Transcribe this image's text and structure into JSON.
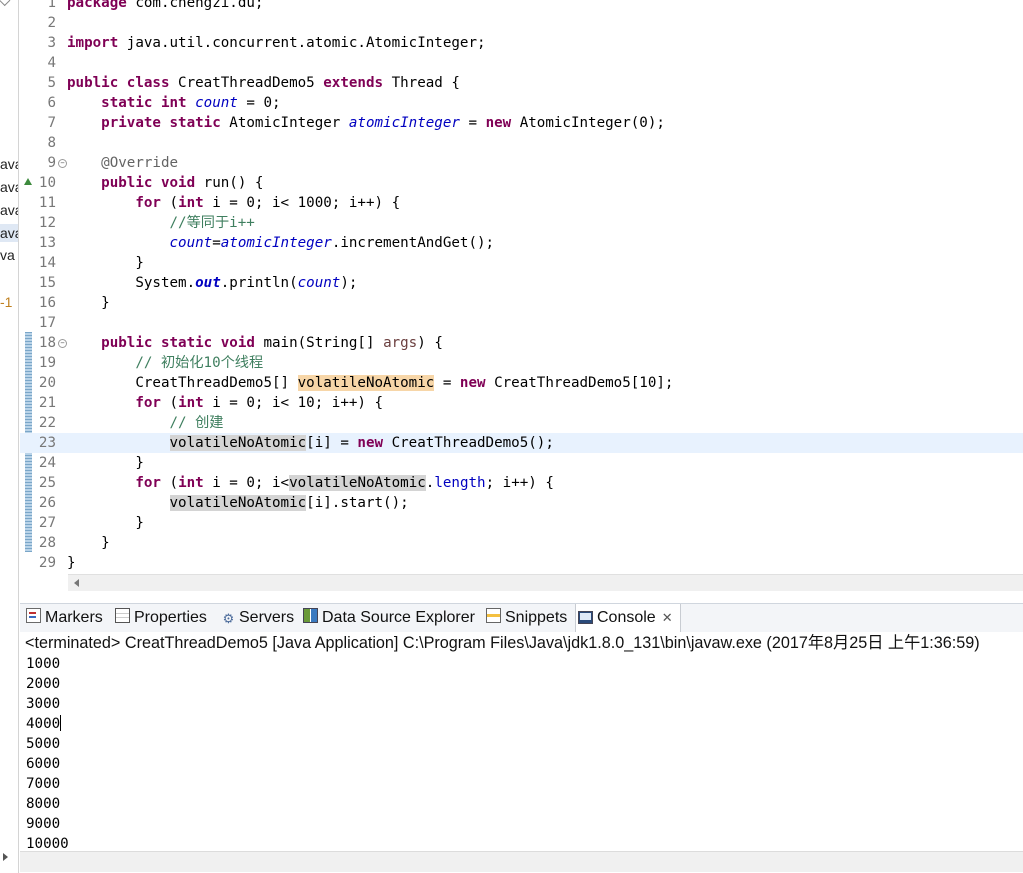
{
  "package_explorer": {
    "fragments": [
      "ava",
      "ava",
      "ava",
      "ava",
      "va",
      "-1"
    ]
  },
  "editor": {
    "current_line": 23,
    "lines": [
      {
        "n": "1",
        "segs": [
          [
            "kw",
            "package"
          ],
          [
            "t",
            " com.chengzi.du;"
          ]
        ]
      },
      {
        "n": "2",
        "segs": []
      },
      {
        "n": "3",
        "segs": [
          [
            "kw",
            "import"
          ],
          [
            "t",
            " java.util.concurrent.atomic.AtomicInteger;"
          ]
        ]
      },
      {
        "n": "4",
        "segs": []
      },
      {
        "n": "5",
        "segs": [
          [
            "kw",
            "public"
          ],
          [
            "t",
            " "
          ],
          [
            "kw",
            "class"
          ],
          [
            "t",
            " CreatThreadDemo5 "
          ],
          [
            "kw",
            "extends"
          ],
          [
            "t",
            " Thread {"
          ]
        ]
      },
      {
        "n": "6",
        "segs": [
          [
            "t",
            "    "
          ],
          [
            "kw",
            "static"
          ],
          [
            "t",
            " "
          ],
          [
            "kw",
            "int"
          ],
          [
            "t",
            " "
          ],
          [
            "fld",
            "count"
          ],
          [
            "t",
            " = 0;"
          ]
        ]
      },
      {
        "n": "7",
        "segs": [
          [
            "t",
            "    "
          ],
          [
            "kw",
            "private"
          ],
          [
            "t",
            " "
          ],
          [
            "kw",
            "static"
          ],
          [
            "t",
            " AtomicInteger "
          ],
          [
            "fld",
            "atomicInteger"
          ],
          [
            "t",
            " = "
          ],
          [
            "kw",
            "new"
          ],
          [
            "t",
            " AtomicInteger(0);"
          ]
        ]
      },
      {
        "n": "8",
        "segs": []
      },
      {
        "n": "9",
        "fold": true,
        "segs": [
          [
            "t",
            "    "
          ],
          [
            "an",
            "@Override"
          ]
        ]
      },
      {
        "n": "10",
        "override": true,
        "segs": [
          [
            "t",
            "    "
          ],
          [
            "kw",
            "public"
          ],
          [
            "t",
            " "
          ],
          [
            "kw",
            "void"
          ],
          [
            "t",
            " run() {"
          ]
        ]
      },
      {
        "n": "11",
        "segs": [
          [
            "t",
            "        "
          ],
          [
            "kw",
            "for"
          ],
          [
            "t",
            " ("
          ],
          [
            "kw",
            "int"
          ],
          [
            "t",
            " i = 0; i< 1000; i++) {"
          ]
        ]
      },
      {
        "n": "12",
        "segs": [
          [
            "t",
            "            "
          ],
          [
            "cm",
            "//等同于i++"
          ]
        ]
      },
      {
        "n": "13",
        "segs": [
          [
            "t",
            "            "
          ],
          [
            "fld",
            "count"
          ],
          [
            "t",
            "="
          ],
          [
            "fld",
            "atomicInteger"
          ],
          [
            "t",
            ".incrementAndGet();"
          ]
        ]
      },
      {
        "n": "14",
        "segs": [
          [
            "t",
            "        }"
          ]
        ]
      },
      {
        "n": "15",
        "segs": [
          [
            "t",
            "        System."
          ],
          [
            "sfld",
            "out"
          ],
          [
            "t",
            ".println("
          ],
          [
            "fld",
            "count"
          ],
          [
            "t",
            ");"
          ]
        ]
      },
      {
        "n": "16",
        "segs": [
          [
            "t",
            "    }"
          ]
        ]
      },
      {
        "n": "17",
        "segs": []
      },
      {
        "n": "18",
        "fold": true,
        "segs": [
          [
            "t",
            "    "
          ],
          [
            "kw",
            "public"
          ],
          [
            "t",
            " "
          ],
          [
            "kw",
            "static"
          ],
          [
            "t",
            " "
          ],
          [
            "kw",
            "void"
          ],
          [
            "t",
            " main(String[] "
          ],
          [
            "prm",
            "args"
          ],
          [
            "t",
            ") {"
          ]
        ]
      },
      {
        "n": "19",
        "segs": [
          [
            "t",
            "        "
          ],
          [
            "cm",
            "// 初始化10个线程"
          ]
        ]
      },
      {
        "n": "20",
        "segs": [
          [
            "t",
            "        CreatThreadDemo5[] "
          ],
          [
            "hlw",
            "volatileNoAtomic"
          ],
          [
            "t",
            " = "
          ],
          [
            "kw",
            "new"
          ],
          [
            "t",
            " CreatThreadDemo5[10];"
          ]
        ]
      },
      {
        "n": "21",
        "segs": [
          [
            "t",
            "        "
          ],
          [
            "kw",
            "for"
          ],
          [
            "t",
            " ("
          ],
          [
            "kw",
            "int"
          ],
          [
            "t",
            " i = 0; i< 10; i++) {"
          ]
        ]
      },
      {
        "n": "22",
        "segs": [
          [
            "t",
            "            "
          ],
          [
            "cm",
            "// 创建"
          ]
        ]
      },
      {
        "n": "23",
        "segs": [
          [
            "t",
            "            "
          ],
          [
            "hlr",
            "volatileNoAtomic"
          ],
          [
            "t",
            "[i] = "
          ],
          [
            "kw",
            "new"
          ],
          [
            "t",
            " CreatThreadDemo5();"
          ]
        ]
      },
      {
        "n": "24",
        "segs": [
          [
            "t",
            "        }"
          ]
        ]
      },
      {
        "n": "25",
        "segs": [
          [
            "t",
            "        "
          ],
          [
            "kw",
            "for"
          ],
          [
            "t",
            " ("
          ],
          [
            "kw",
            "int"
          ],
          [
            "t",
            " i = 0; i<"
          ],
          [
            "hlr",
            "volatileNoAtomic"
          ],
          [
            "t",
            "."
          ],
          [
            "pfld",
            "length"
          ],
          [
            "t",
            "; i++) {"
          ]
        ]
      },
      {
        "n": "26",
        "segs": [
          [
            "t",
            "            "
          ],
          [
            "hlr",
            "volatileNoAtomic"
          ],
          [
            "t",
            "[i].start();"
          ]
        ]
      },
      {
        "n": "27",
        "segs": [
          [
            "t",
            "        }"
          ]
        ]
      },
      {
        "n": "28",
        "segs": [
          [
            "t",
            "    }"
          ]
        ]
      },
      {
        "n": "29",
        "segs": [
          [
            "t",
            "}"
          ]
        ]
      }
    ]
  },
  "views": {
    "tabs": [
      {
        "id": "markers",
        "label": "Markers",
        "icon": "markers-icon"
      },
      {
        "id": "properties",
        "label": "Properties",
        "icon": "properties-icon"
      },
      {
        "id": "servers",
        "label": "Servers",
        "icon": "servers-icon"
      },
      {
        "id": "data-source-explorer",
        "label": "Data Source Explorer",
        "icon": "data-source-explorer-icon"
      },
      {
        "id": "snippets",
        "label": "Snippets",
        "icon": "snippets-icon"
      },
      {
        "id": "console",
        "label": "Console",
        "icon": "console-icon",
        "active": true
      }
    ]
  },
  "console": {
    "status": "<terminated> CreatThreadDemo5 [Java Application] C:\\Program Files\\Java\\jdk1.8.0_131\\bin\\javaw.exe (2017年8月25日 上午1:36:59)",
    "output": [
      "1000",
      "2000",
      "3000",
      "4000",
      "5000",
      "6000",
      "7000",
      "8000",
      "9000",
      "10000"
    ],
    "caret_after_line": 3
  },
  "colors": {
    "keyword": "#7f0055",
    "field": "#0000c0",
    "comment": "#3f7f5f",
    "annotation": "#646464",
    "current_line_bg": "#e8f2fe",
    "write_occurrence_bg": "#f7d6a8",
    "read_occurrence_bg": "#d4d4d4"
  }
}
